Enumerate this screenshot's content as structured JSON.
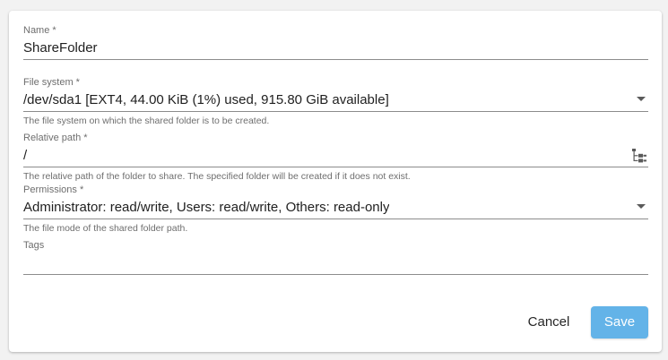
{
  "form": {
    "name": {
      "label": "Name *",
      "value": "ShareFolder"
    },
    "file_system": {
      "label": "File system *",
      "value": "/dev/sda1 [EXT4, 44.00 KiB (1%) used, 915.80 GiB available]",
      "hint": "The file system on which the shared folder is to be created."
    },
    "relative_path": {
      "label": "Relative path *",
      "value": "/",
      "hint": "The relative path of the folder to share. The specified folder will be created if it does not exist."
    },
    "permissions": {
      "label": "Permissions *",
      "value": "Administrator: read/write, Users: read/write, Others: read-only",
      "hint": "The file mode of the shared folder path."
    },
    "tags": {
      "label": "Tags",
      "value": ""
    }
  },
  "actions": {
    "cancel_label": "Cancel",
    "save_label": "Save"
  },
  "colors": {
    "save_button": "#63b3e8",
    "underline": "#8c8c8c"
  },
  "icons": {
    "file_system_dropdown": "chevron-down-icon",
    "relative_path_picker": "folder-tree-icon",
    "permissions_dropdown": "chevron-down-icon"
  }
}
